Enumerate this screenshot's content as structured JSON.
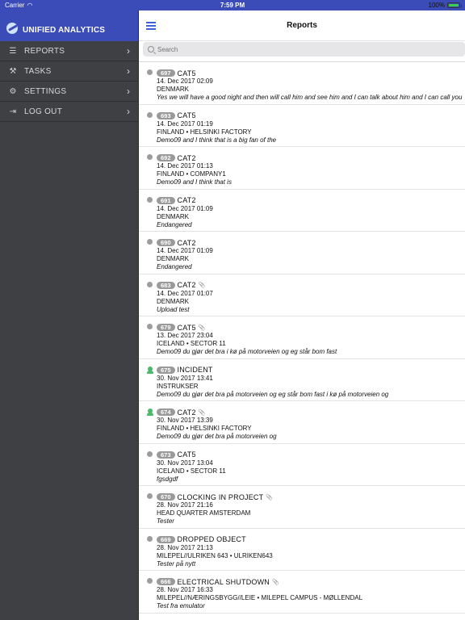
{
  "status": {
    "carrier": "Carrier",
    "time": "7:59 PM",
    "battery": "100%"
  },
  "app": {
    "title": "UNIFIED ANALYTICS"
  },
  "menu": [
    {
      "label": "REPORTS",
      "icon": "list-icon"
    },
    {
      "label": "TASKS",
      "icon": "wrench-icon"
    },
    {
      "label": "SETTINGS",
      "icon": "gear-icon"
    },
    {
      "label": "LOG OUT",
      "icon": "logout-icon"
    }
  ],
  "header": {
    "title": "Reports"
  },
  "search": {
    "placeholder": "Search"
  },
  "reports": [
    {
      "id": "697",
      "category": "CAT5",
      "date": "14. Dec 2017 02:09",
      "location": "DENMARK",
      "description": "Yes we will have a good night and then will call him and see him and I can talk about him and I can call you",
      "attachment": false,
      "marker": "dot"
    },
    {
      "id": "693",
      "category": "CAT5",
      "date": "14. Dec 2017 01:19",
      "location": "FINLAND • HELSINKI FACTORY",
      "description": "Demo09 and I think that is a big fan of the",
      "attachment": false,
      "marker": "dot"
    },
    {
      "id": "692",
      "category": "CAT2",
      "date": "14. Dec 2017 01:13",
      "location": "FINLAND • COMPANY1",
      "description": "Demo09 and I think that is",
      "attachment": false,
      "marker": "dot"
    },
    {
      "id": "691",
      "category": "CAT2",
      "date": "14. Dec 2017 01:09",
      "location": "DENMARK",
      "description": "Endangered",
      "attachment": false,
      "marker": "dot"
    },
    {
      "id": "690",
      "category": "CAT2",
      "date": "14. Dec 2017 01:09",
      "location": "DENMARK",
      "description": "Endangered",
      "attachment": false,
      "marker": "dot"
    },
    {
      "id": "683",
      "category": "CAT2",
      "date": "14. Dec 2017 01:07",
      "location": "DENMARK",
      "description": "Upload test",
      "attachment": true,
      "marker": "dot"
    },
    {
      "id": "679",
      "category": "CAT5",
      "date": "13. Dec 2017 23:04",
      "location": "ICELAND • SECTOR 11",
      "description": "Demo09 du gjør det bra i kø på motorveien og eg står bom fast",
      "attachment": true,
      "marker": "dot"
    },
    {
      "id": "675",
      "category": "INCIDENT",
      "date": "30. Nov 2017 13:41",
      "location": "INSTRUKSER",
      "description": "Demo09 du gjør det bra på motorveien og eg står bom fast i kø på motorveien og",
      "attachment": false,
      "marker": "person"
    },
    {
      "id": "674",
      "category": "CAT2",
      "date": "30. Nov 2017 13:39",
      "location": "FINLAND • HELSINKI FACTORY",
      "description": "Demo09 du gjør det bra på motorveien og",
      "attachment": true,
      "marker": "person"
    },
    {
      "id": "673",
      "category": "CAT5",
      "date": "30. Nov 2017 13:04",
      "location": "ICELAND • SECTOR 11",
      "description": "fgsdgdf",
      "attachment": false,
      "marker": "dot"
    },
    {
      "id": "670",
      "category": "CLOCKING IN PROJECT",
      "date": "28. Nov 2017 21:16",
      "location": "HEAD QUARTER AMSTERDAM",
      "description": "Tester",
      "attachment": true,
      "marker": "dot"
    },
    {
      "id": "669",
      "category": "DROPPED OBJECT",
      "date": "28. Nov 2017 21:13",
      "location": "MILEPEL//ULRIKEN 643 • ULRIKEN643",
      "description": "Tester på nytt",
      "attachment": false,
      "marker": "dot"
    },
    {
      "id": "666",
      "category": "ELECTRICAL SHUTDOWN",
      "date": "28. Nov 2017 16:33",
      "location": "MILEPEL//NÆRINGSBYGG//LEIE • MILEPEL CAMPUS - MØLLENDAL",
      "description": "Test fra emulator",
      "attachment": true,
      "marker": "dot"
    }
  ]
}
